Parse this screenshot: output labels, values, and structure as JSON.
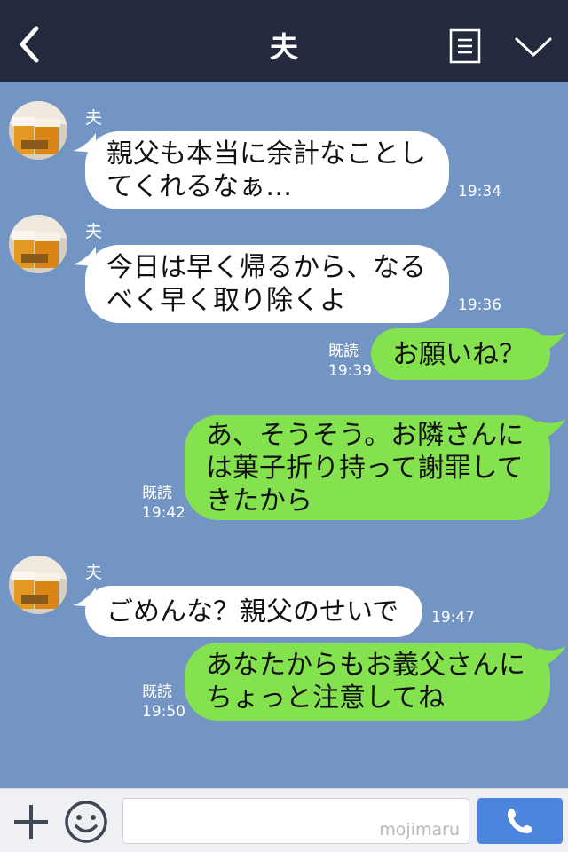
{
  "header": {
    "title": "夫",
    "back_icon": "chevron-left-icon",
    "menu_icon": "note-list-icon",
    "collapse_icon": "chevron-down-icon",
    "background": "#232a3d"
  },
  "chat": {
    "background": "#7395c4",
    "messages": [
      {
        "side": "in",
        "sender": "夫",
        "lines": [
          "親父も本当に余計なことし",
          "てくれるなぁ…"
        ],
        "time": "19:34"
      },
      {
        "side": "in",
        "sender": "夫",
        "lines": [
          "今日は早く帰るから、なる",
          "べく早く取り除くよ"
        ],
        "time": "19:36"
      },
      {
        "side": "out",
        "read": "既読",
        "lines": [
          "お願いね？"
        ],
        "time": "19:39"
      },
      {
        "side": "out",
        "read": "既読",
        "lines": [
          "あ、そうそう。お隣さんに",
          "は菓子折り持って謝罪して",
          "きたから"
        ],
        "time": "19:42"
      },
      {
        "side": "in",
        "sender": "夫",
        "lines": [
          "ごめんな？親父のせいで"
        ],
        "time": "19:47"
      },
      {
        "side": "out",
        "read": "既読",
        "lines": [
          "あなたからもお義父さんに",
          "ちょっと注意してね"
        ],
        "time": "19:50"
      }
    ],
    "incoming_bubble_color": "#ffffff",
    "outgoing_bubble_color": "#84e24e"
  },
  "input_bar": {
    "plus_icon": "plus-icon",
    "emoji_icon": "smiley-icon",
    "watermark": "mojimaru",
    "call_icon": "phone-icon",
    "call_button_color": "#4d85de"
  }
}
